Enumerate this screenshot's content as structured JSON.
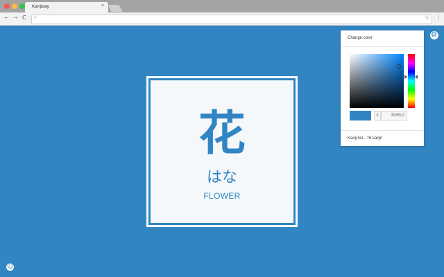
{
  "browser": {
    "tab_title": "Kanjiday",
    "tab_close": "×",
    "nav_back": "←",
    "nav_forward": "→",
    "nav_reload": "C",
    "omnibox_icon": "⌕",
    "omnibox_value": "",
    "star": "☆",
    "menu": "⋮"
  },
  "card": {
    "kanji": "花",
    "reading": "はな",
    "meaning": "FLOWER"
  },
  "settings": {
    "gear_icon": "⚙",
    "panel_title": "Change color",
    "hex_prefix": "#",
    "hex_value": "3085c2",
    "kanji_list_text": "Kanji list - 76 kanji!"
  },
  "bottom": {
    "smile_icon": "☺"
  },
  "colors": {
    "background": "#3085c2",
    "card": "#f4f8fb"
  }
}
